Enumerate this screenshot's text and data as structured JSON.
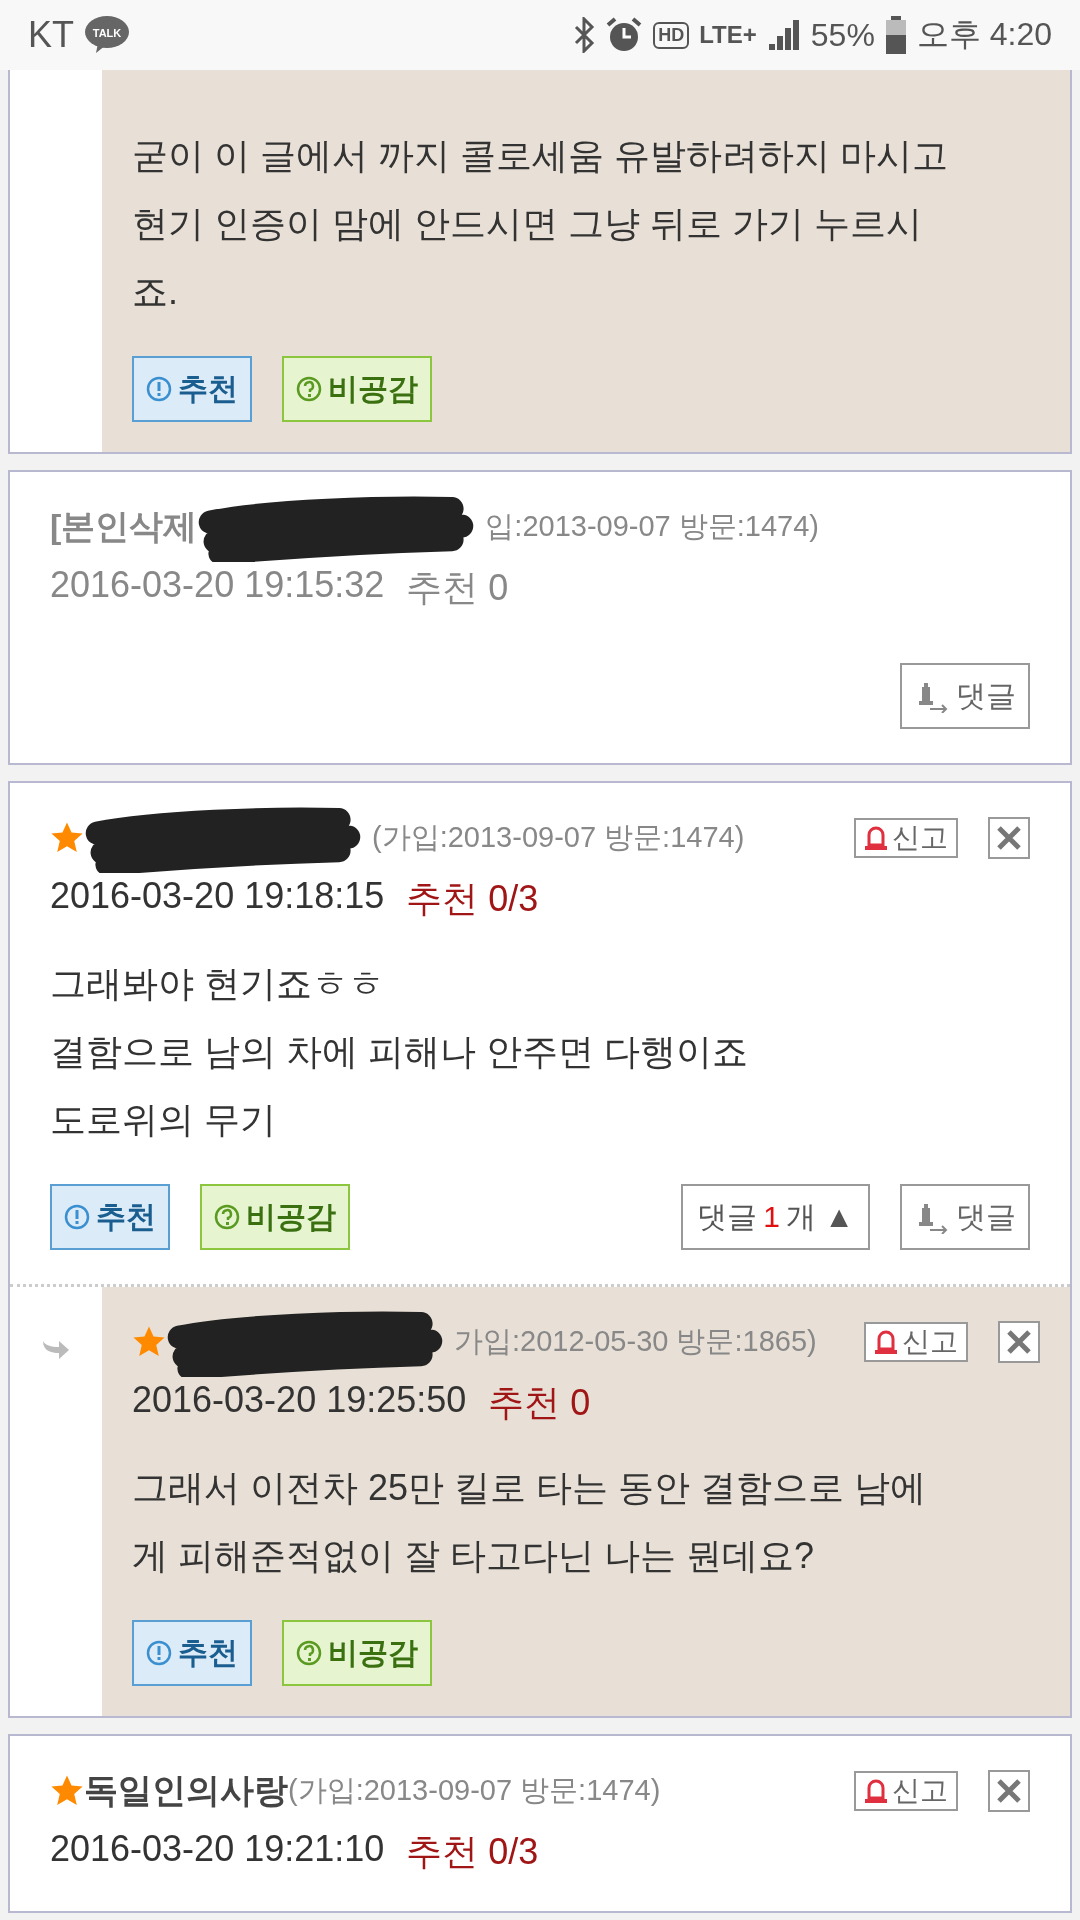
{
  "status_bar": {
    "carrier": "KT",
    "talk_badge": "TALK",
    "hd": "HD",
    "network": "LTE+",
    "battery": "55%",
    "time": "오후 4:20"
  },
  "cards": [
    {
      "replies": [
        {
          "lines": [
            "굳이 이 글에서 까지 콜로세움 유발하려하지 마시고",
            "현기 인증이 맘에 안드시면 그냥 뒤로 가기 누르시",
            "죠."
          ],
          "actions": [
            {
              "kind": "recommend",
              "label": "추천"
            },
            {
              "kind": "disagree",
              "label": "비공감"
            }
          ]
        }
      ]
    },
    {
      "author": {
        "name": "[본인삭제",
        "starred": false,
        "redacted": true,
        "info": "입:2013-09-07 방문:1474)",
        "deleted": true
      },
      "date": "2016-03-20 19:15:32",
      "votes": "추천 0",
      "actions": [
        {
          "kind": "reply",
          "label": "댓글"
        }
      ]
    },
    {
      "author": {
        "starred": true,
        "redacted": true,
        "info": "(가입:2013-09-07 방문:1474)",
        "deleted": false
      },
      "header_buttons": [
        {
          "kind": "report",
          "label": "신고"
        },
        {
          "kind": "close"
        }
      ],
      "date": "2016-03-20 19:18:15",
      "votes": "추천 0/3",
      "lines": [
        "그래봐야 현기죠ㅎㅎ",
        "결함으로 남의 차에 피해나 안주면 다행이죠",
        "도로위의 무기"
      ],
      "actions": [
        {
          "kind": "recommend",
          "label": "추천"
        },
        {
          "kind": "disagree",
          "label": "비공감"
        },
        {
          "kind": "replies",
          "label": "댓글",
          "count": "1",
          "unit": "개",
          "arrow": "▲"
        },
        {
          "kind": "reply",
          "label": "댓글"
        }
      ],
      "replies": [
        {
          "author": {
            "starred": true,
            "redacted": true,
            "info": "가입:2012-05-30 방문:1865)",
            "deleted": false
          },
          "header_buttons": [
            {
              "kind": "report",
              "label": "신고"
            },
            {
              "kind": "close"
            }
          ],
          "date": "2016-03-20 19:25:50",
          "votes": "추천 0",
          "lines": [
            "그래서 이전차 25만 킬로 타는 동안 결함으로 남에",
            "게 피해준적없이 잘 타고다닌 나는 뭔데요?"
          ],
          "actions": [
            {
              "kind": "recommend",
              "label": "추천"
            },
            {
              "kind": "disagree",
              "label": "비공감"
            }
          ]
        }
      ]
    },
    {
      "author": {
        "name": "독일인의사랑",
        "starred": true,
        "redacted": false,
        "info": "(가입:2013-09-07 방문:1474)",
        "deleted": false
      },
      "header_buttons": [
        {
          "kind": "report",
          "label": "신고"
        },
        {
          "kind": "close"
        }
      ],
      "date": "2016-03-20 19:21:10",
      "votes": "추천 0/3"
    }
  ]
}
